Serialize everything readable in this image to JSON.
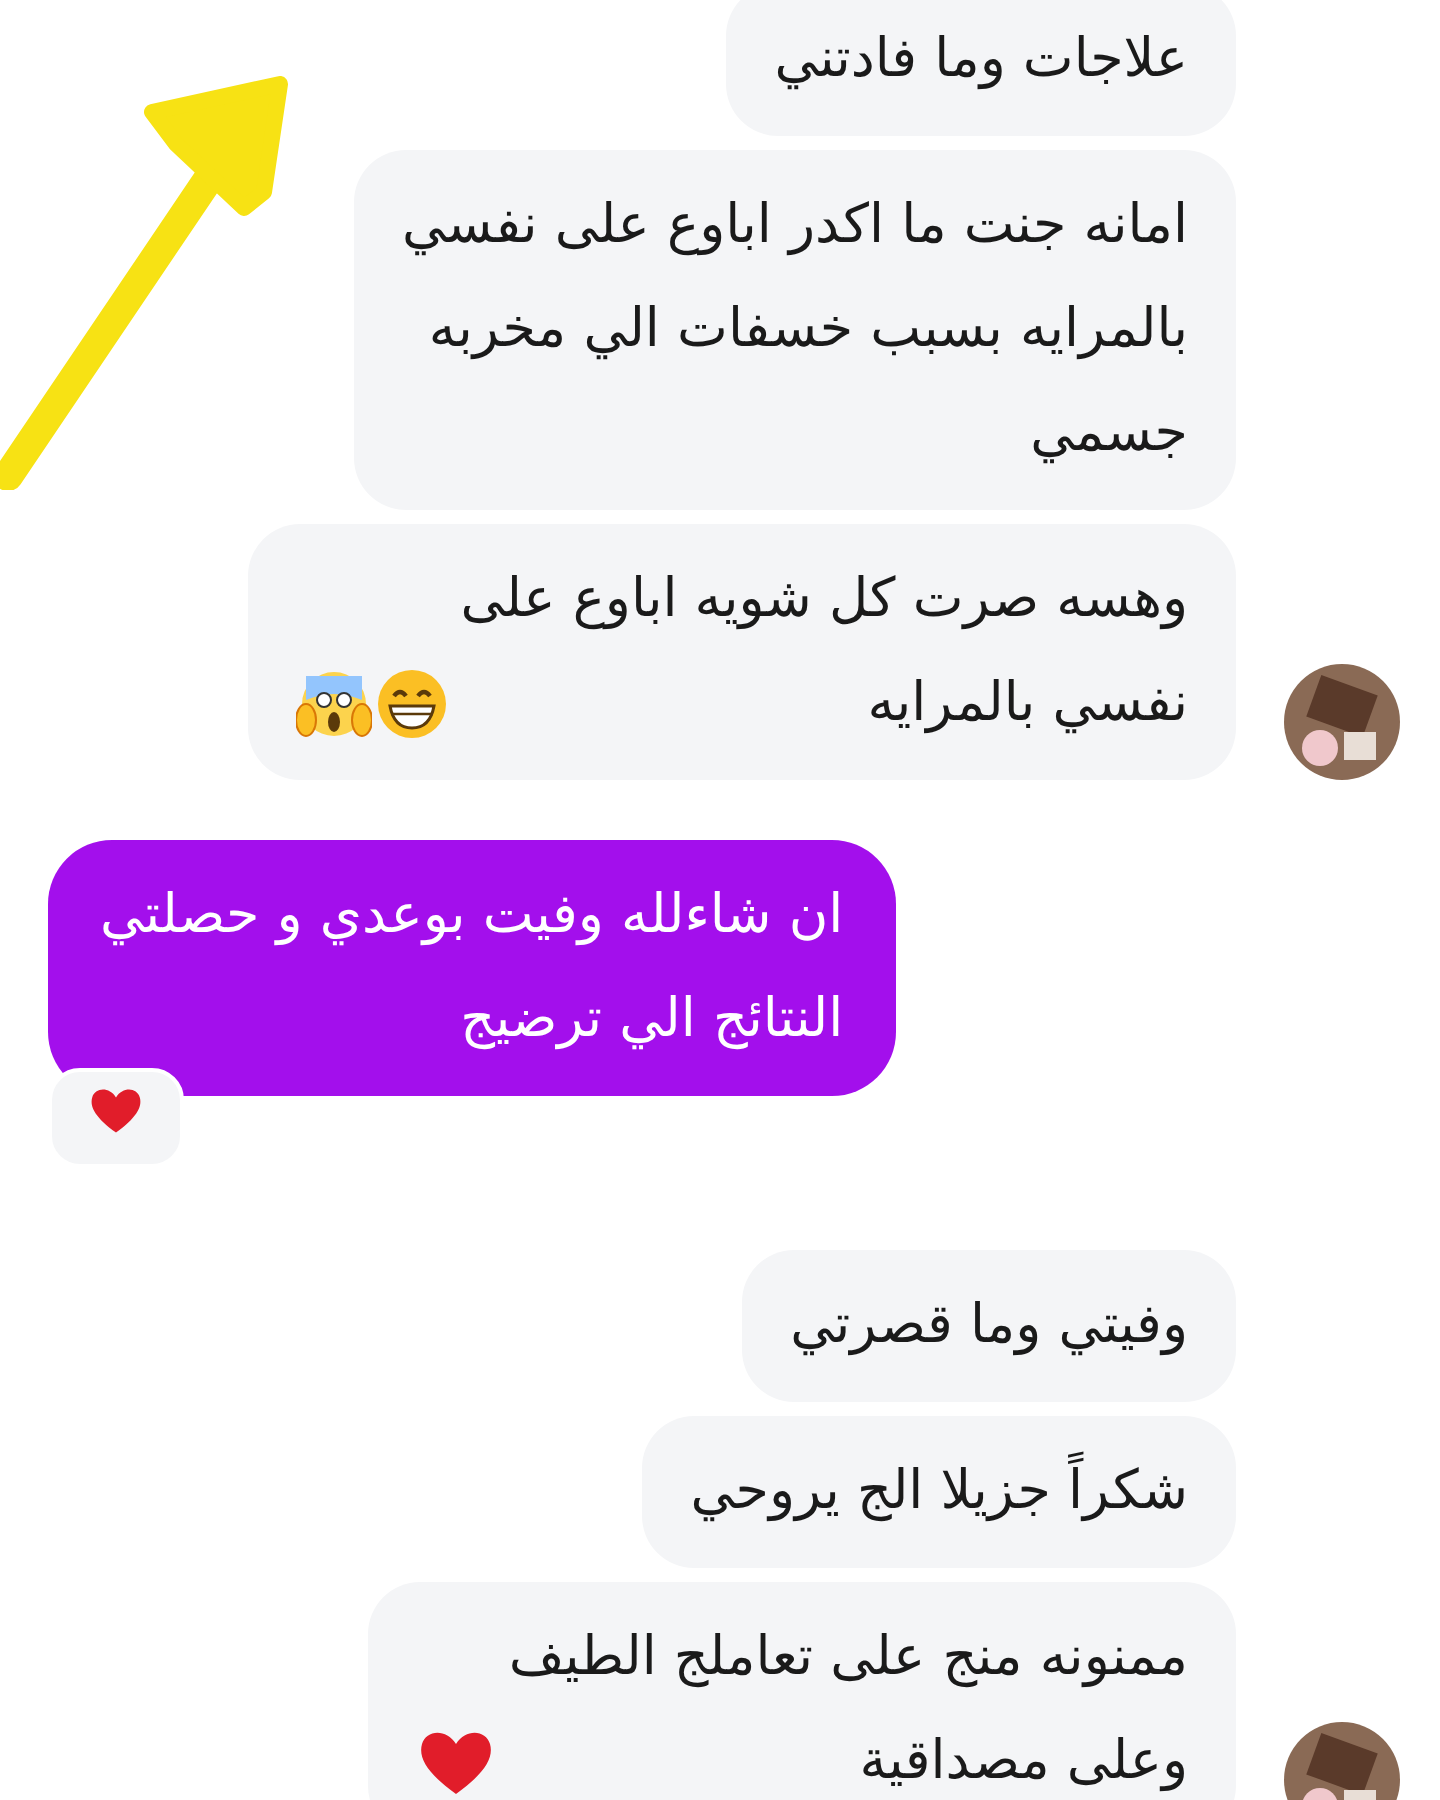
{
  "messages": [
    {
      "kind": "incoming",
      "text": "علاجات وما فادتني",
      "avatar": false
    },
    {
      "kind": "incoming",
      "text": "امانه جنت ما اكدر اباوع على نفسي\nبالمرايه بسبب خسفات  الي مخربه\nجسمي",
      "avatar": false
    },
    {
      "kind": "incoming",
      "text": "وهسه صرت كل شويه اباوع على\nنفسي بالمرايه",
      "avatar": true,
      "icons": [
        {
          "kind": "grin"
        },
        {
          "kind": "scream"
        }
      ]
    },
    {
      "kind": "outgoing",
      "text": "ان شاءلله وفيت بوعدي و حصلتي\nالنتائج الي ترضيج",
      "reaction": {
        "kind": "heart"
      }
    },
    {
      "kind": "incoming",
      "text": "وفيتي وما قصرتي",
      "avatar": false
    },
    {
      "kind": "incoming",
      "text": "شكراً جزيلا الج يروحي",
      "avatar": false
    },
    {
      "kind": "incoming",
      "text": "ممنونه منج على تعاملج الطيف\nوعلى مصداقية",
      "avatar": true,
      "icons": [
        {
          "kind": "heart"
        }
      ]
    }
  ],
  "annotation": {
    "kind": "arrow"
  }
}
